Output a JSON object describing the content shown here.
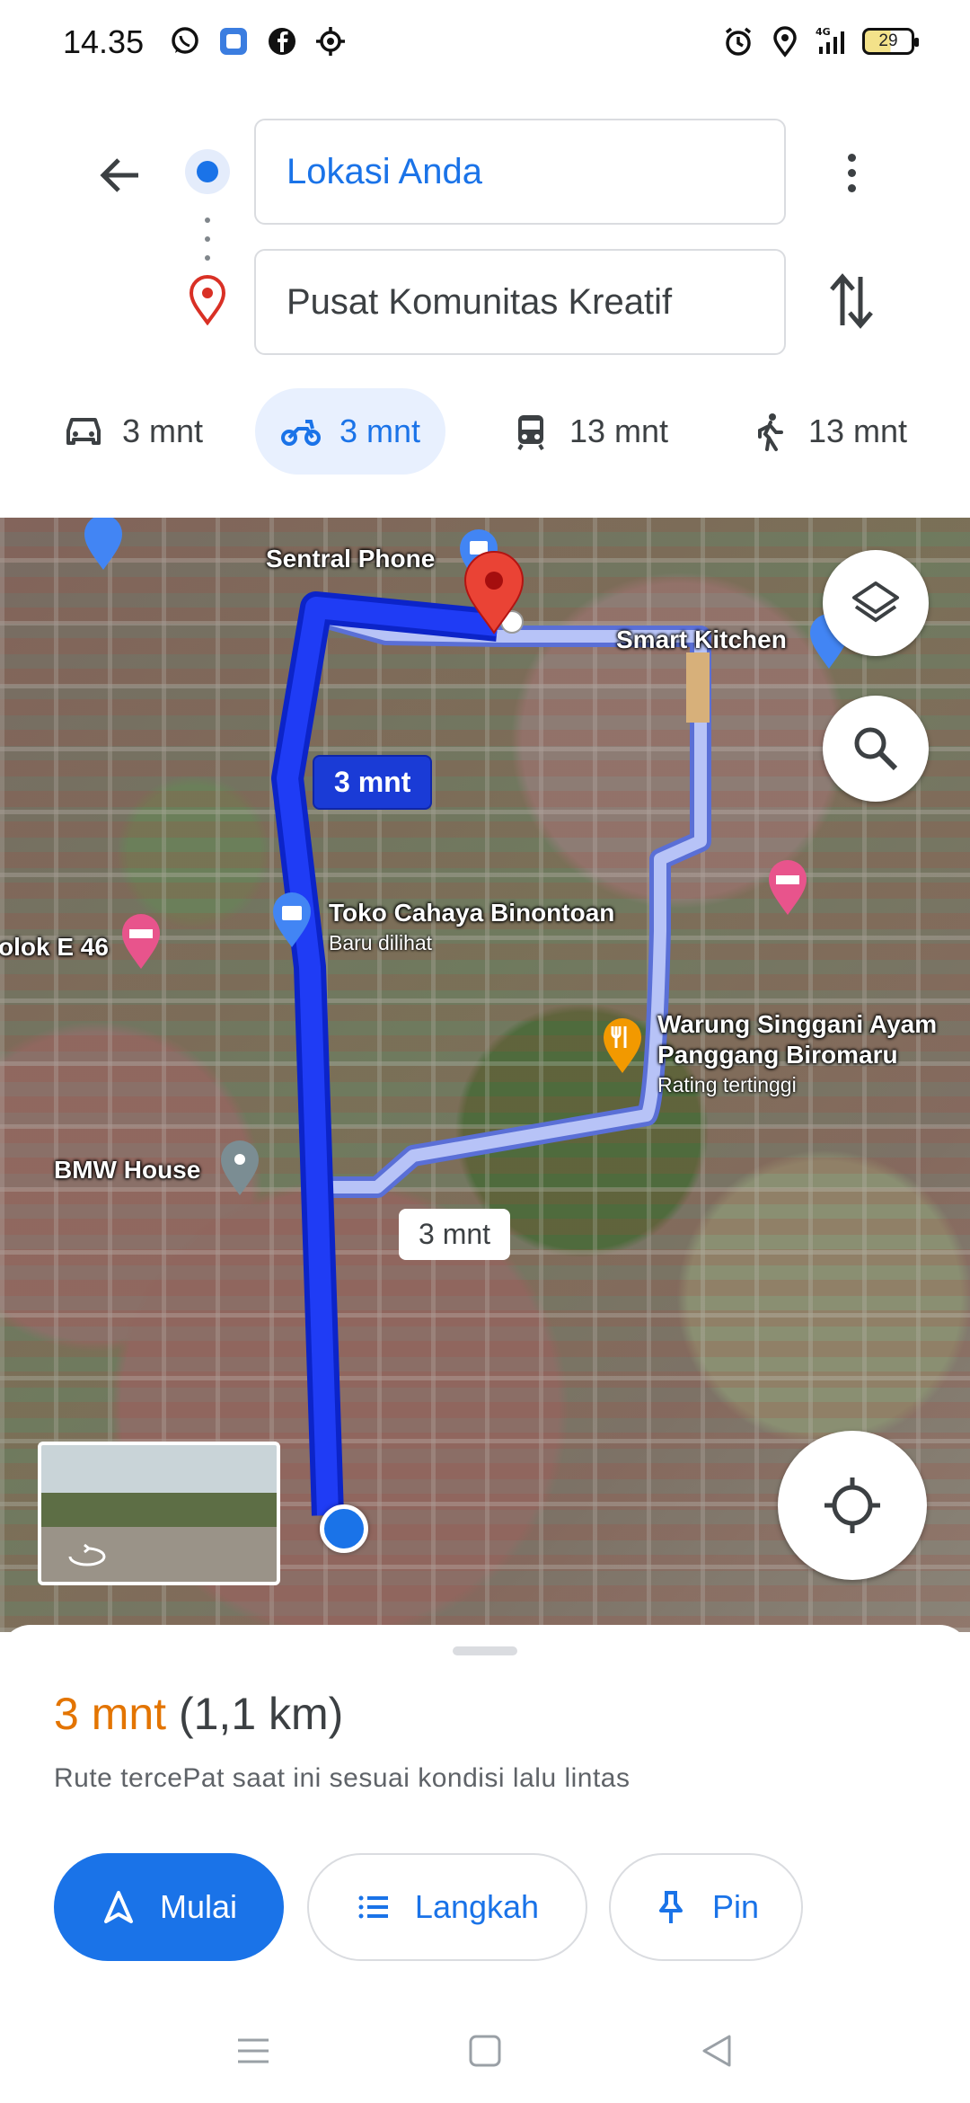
{
  "status_bar": {
    "time": "14.35",
    "battery": "29",
    "icons": [
      "whatsapp-icon",
      "app-icon",
      "facebook-icon",
      "location-target-icon",
      "alarm-icon",
      "location-icon",
      "signal-4g-icon",
      "battery-icon"
    ]
  },
  "search": {
    "origin": "Lokasi Anda",
    "destination": "Pusat Komunitas Kreatif"
  },
  "modes": [
    {
      "icon": "car-icon",
      "label": "3 mnt",
      "active": false
    },
    {
      "icon": "motorcycle-icon",
      "label": "3 mnt",
      "active": true
    },
    {
      "icon": "transit-icon",
      "label": "13 mnt",
      "active": false
    },
    {
      "icon": "walk-icon",
      "label": "13 mnt",
      "active": false
    }
  ],
  "map": {
    "places": {
      "sentral_phone": "Sentral Phone",
      "smart_kitchen": "Smart Kitchen",
      "toko": "Toko Cahaya Binontoan",
      "toko_sub": "Baru dilihat",
      "blok": "olok E 46",
      "warung_line1": "Warung Singgani Ayam",
      "warung_line2": "Panggang Biromaru",
      "warung_sub": "Rating tertinggi",
      "bmw": "BMW House"
    },
    "route_main_label": "3 mnt",
    "route_alt_label": "3 mnt",
    "colors": {
      "route_main": "#1a3bf0",
      "route_alt": "#a9b8f5",
      "accent": "#1a73e8"
    }
  },
  "sheet": {
    "duration": "3 mnt",
    "distance": "(1,1 km)",
    "subtitle": "Rute tercePat saat ini sesuai kondisi lalu lintas",
    "buttons": {
      "start": "Mulai",
      "steps": "Langkah",
      "pin": "Pin"
    },
    "duration_color": "#e37400"
  }
}
